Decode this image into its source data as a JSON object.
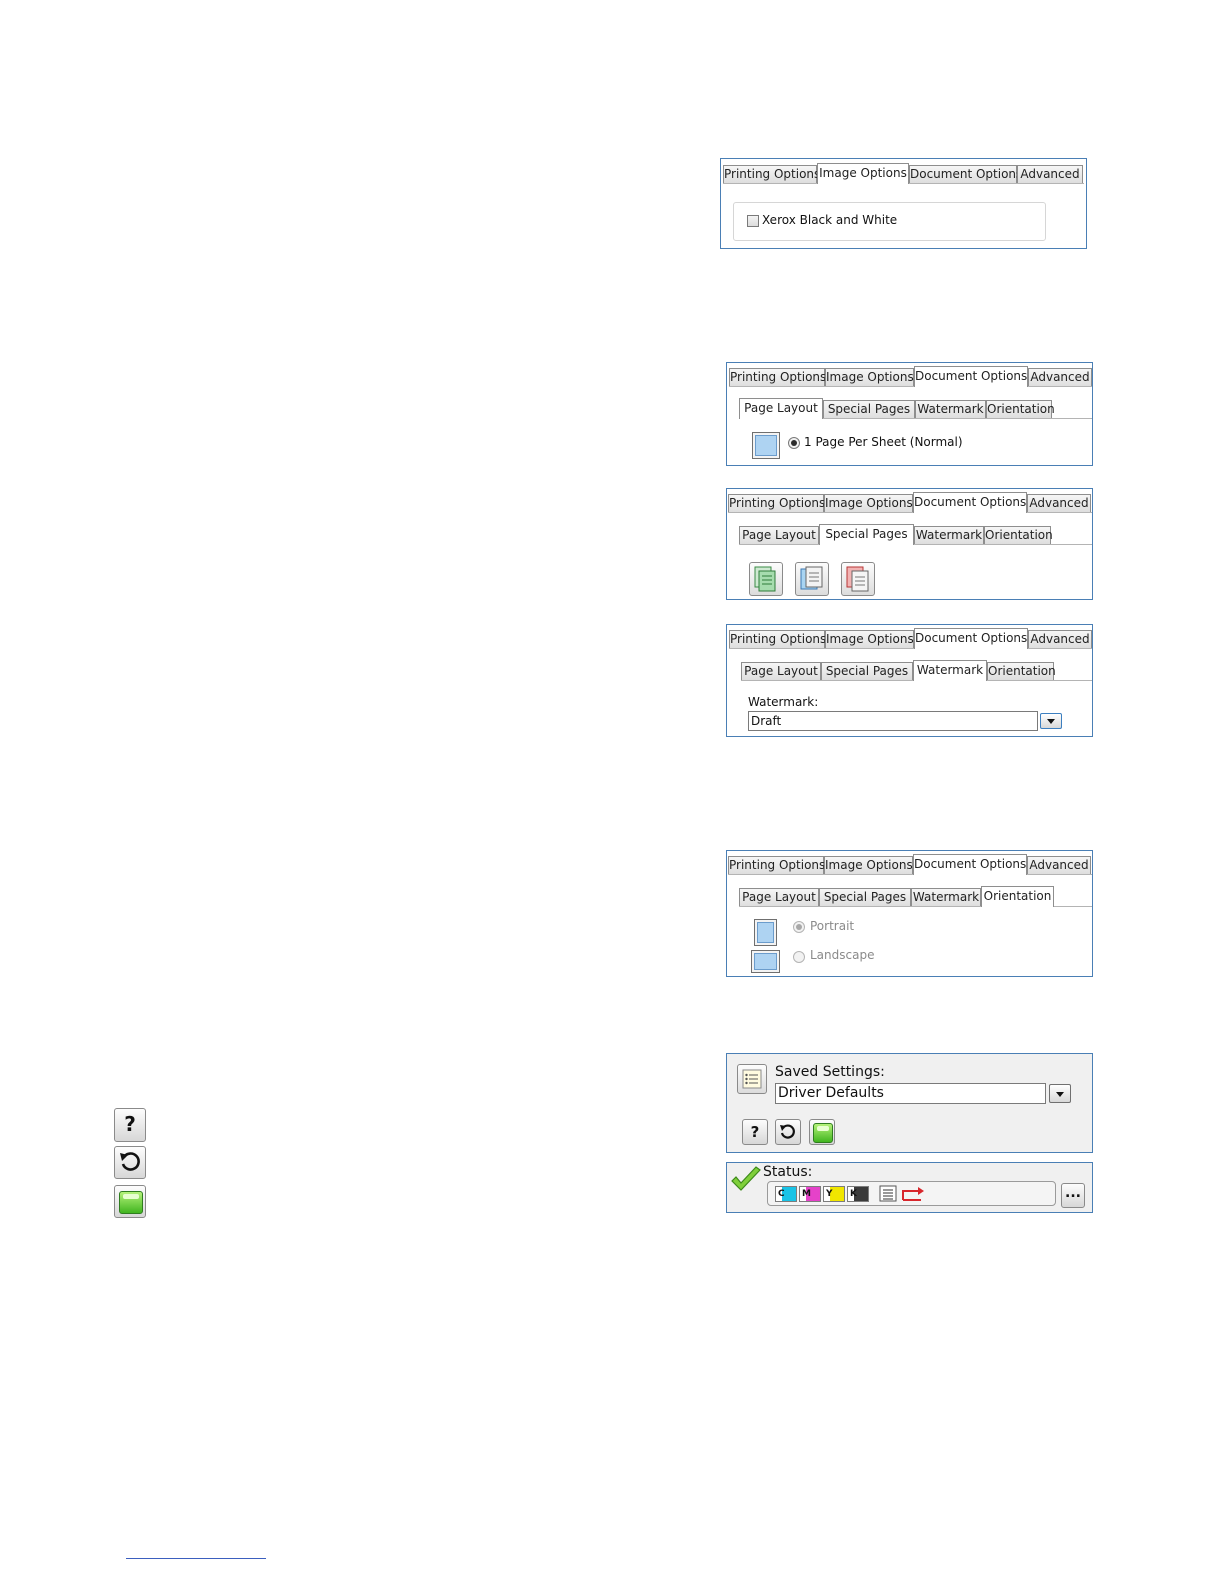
{
  "main_tabs": [
    "Printing Options",
    "Image Options",
    "Document Options",
    "Advanced"
  ],
  "sub_tabs": [
    "Page Layout",
    "Special Pages",
    "Watermark",
    "Orientation"
  ],
  "panel_image_options": {
    "active_tab": "Image Options",
    "checkbox_label": "Xerox Black and White",
    "checkbox_checked": false
  },
  "panel_page_layout": {
    "active_tab": "Document Options",
    "active_sub_tab": "Page Layout",
    "radio_label": "1 Page Per Sheet (Normal)",
    "radio_checked": true
  },
  "panel_special_pages": {
    "active_tab": "Document Options",
    "active_sub_tab": "Special Pages",
    "icons": [
      "covers-icon",
      "inserts-icon",
      "exceptions-icon"
    ]
  },
  "panel_watermark": {
    "active_tab": "Document Options",
    "active_sub_tab": "Watermark",
    "field_label": "Watermark:",
    "field_value": "Draft"
  },
  "panel_orientation": {
    "active_tab": "Document Options",
    "active_sub_tab": "Orientation",
    "options": [
      {
        "label": "Portrait",
        "selected": true,
        "enabled": false
      },
      {
        "label": "Landscape",
        "selected": false,
        "enabled": false
      }
    ]
  },
  "saved_settings": {
    "label": "Saved Settings:",
    "value": "Driver Defaults"
  },
  "status": {
    "label": "Status:",
    "inks": [
      {
        "letter": "C",
        "color": "#19c3e6"
      },
      {
        "letter": "M",
        "color": "#e542c9"
      },
      {
        "letter": "Y",
        "color": "#f1e600"
      },
      {
        "letter": "K",
        "color": "#3a3a3a"
      }
    ],
    "more_button": "..."
  },
  "legend_icons": [
    "help-icon",
    "restore-defaults-icon",
    "eco-icon"
  ],
  "colors": {
    "panel_border": "#4a7fb5",
    "tab_border": "#8e8e8e",
    "accent_green": "#41b520"
  }
}
